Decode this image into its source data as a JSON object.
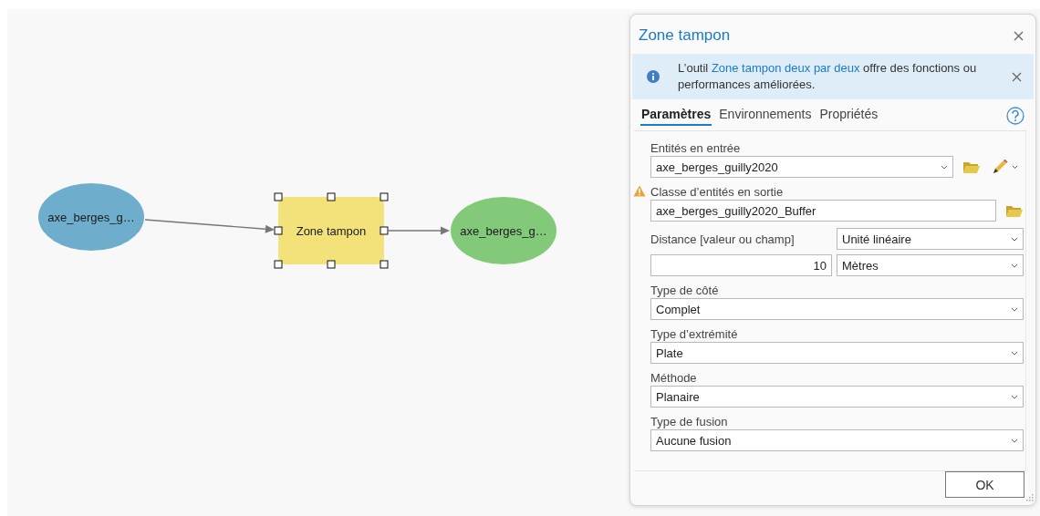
{
  "diagram": {
    "nodes": [
      {
        "kind": "data",
        "label": "axe_berges_g…",
        "color": "#6eaecc",
        "selected": false
      },
      {
        "kind": "tool",
        "label": "Zone tampon",
        "color": "#f3e27a",
        "selected": true
      },
      {
        "kind": "data",
        "label": "axe_berges_g…",
        "color": "#82c97a",
        "selected": false
      }
    ]
  },
  "dialog": {
    "title": "Zone tampon",
    "banner": {
      "text_before": "L’outil ",
      "link": "Zone tampon deux par deux",
      "text_after": " offre des fonctions ou performances améliorées."
    },
    "tabs": [
      {
        "label": "Paramètres",
        "selected": true
      },
      {
        "label": "Environnements",
        "selected": false
      },
      {
        "label": "Propriétés",
        "selected": false
      }
    ],
    "parameters": [
      {
        "kind": "input_layer",
        "label": "Entités en entrée",
        "value": "axe_berges_guilly2020",
        "warning": false
      },
      {
        "kind": "output",
        "label": "Classe d’entités en sortie",
        "value": "axe_berges_guilly2020_Buffer",
        "warning": true
      },
      {
        "kind": "distance",
        "label": "Distance [valeur ou champ]",
        "type": "Unité linéaire",
        "value": "10",
        "unit": "Mètres",
        "warning": false
      },
      {
        "kind": "select",
        "label": "Type de côté",
        "value": "Complet",
        "warning": false
      },
      {
        "kind": "select",
        "label": "Type d’extrémité",
        "value": "Plate",
        "warning": false
      },
      {
        "kind": "select",
        "label": "Méthode",
        "value": "Planaire",
        "warning": false
      },
      {
        "kind": "select",
        "label": "Type de fusion",
        "value": "Aucune fusion",
        "warning": false
      }
    ],
    "buttons": [
      "OK"
    ]
  }
}
